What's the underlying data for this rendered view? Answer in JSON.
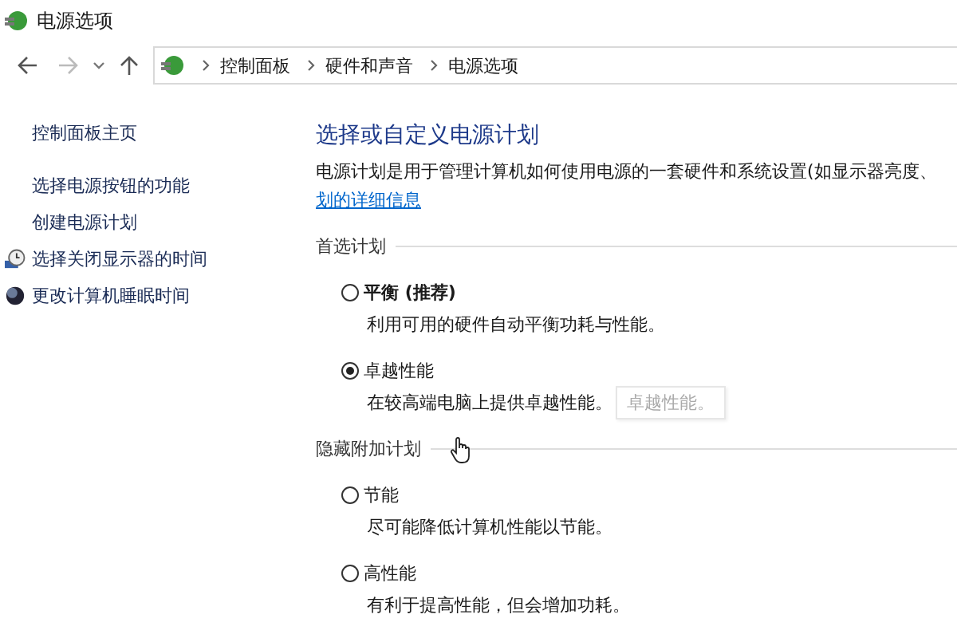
{
  "window": {
    "title": "电源选项"
  },
  "address_bar": {
    "breadcrumbs": [
      "控制面板",
      "硬件和声音",
      "电源选项"
    ]
  },
  "sidebar": {
    "items": [
      {
        "label": "控制面板主页",
        "kind": "home"
      },
      {
        "label": "选择电源按钮的功能",
        "kind": "link"
      },
      {
        "label": "创建电源计划",
        "kind": "link"
      },
      {
        "label": "选择关闭显示器的时间",
        "kind": "clock"
      },
      {
        "label": "更改计算机睡眠时间",
        "kind": "sleep"
      }
    ]
  },
  "main": {
    "title": "选择或自定义电源计划",
    "description": "电源计划是用于管理计算机如何使用电源的一套硬件和系统设置(如显示器亮度、",
    "link": "划的详细信息",
    "groups": [
      {
        "label": "首选计划",
        "plans": [
          {
            "name": "平衡 (推荐)",
            "description": "利用可用的硬件自动平衡功耗与性能。",
            "selected": false
          },
          {
            "name": "卓越性能",
            "description": "在较高端电脑上提供卓越性能。",
            "selected": true,
            "tooltip": "卓越性能。"
          }
        ]
      },
      {
        "label": "隐藏附加计划",
        "plans": [
          {
            "name": "节能",
            "description": "尽可能降低计算机性能以节能。",
            "selected": false
          },
          {
            "name": "高性能",
            "description": "有利于提高性能，但会增加功耗。",
            "selected": false
          }
        ]
      }
    ]
  }
}
